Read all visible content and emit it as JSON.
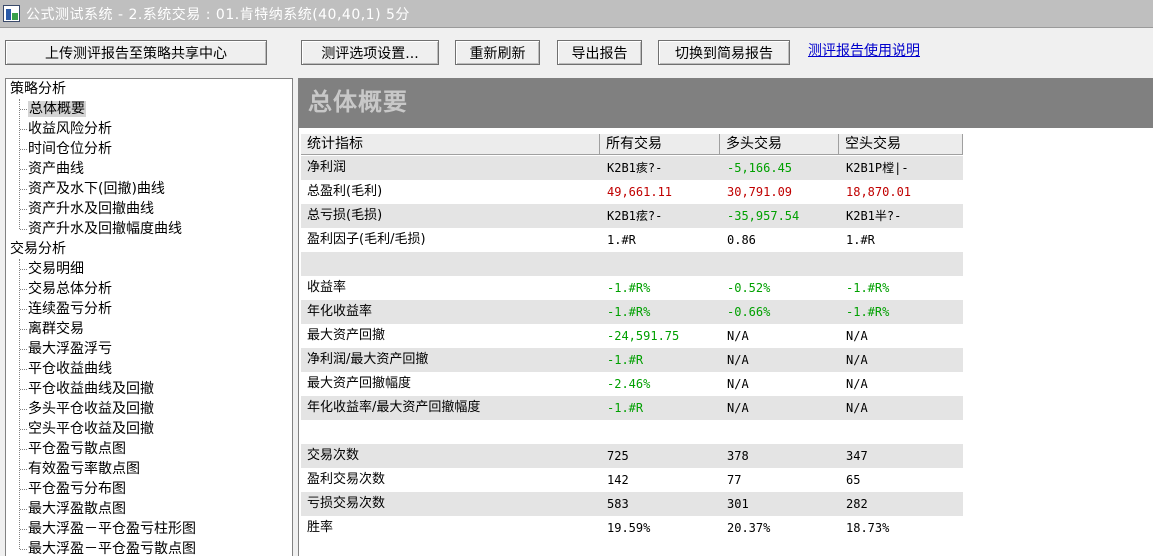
{
  "titlebar": {
    "title": "公式测试系统 - 2.系统交易 : 01.肯特纳系统(40,40,1) 5分"
  },
  "toolbar": {
    "upload_label": "上传测评报告至策略共享中心",
    "options_label": "测评选项设置...",
    "refresh_label": "重新刷新",
    "export_label": "导出报告",
    "simple_label": "切换到简易报告",
    "help_link": "测评报告使用说明"
  },
  "tree": {
    "groups": [
      {
        "label": "策略分析",
        "items": [
          "总体概要",
          "收益风险分析",
          "时间仓位分析",
          "资产曲线",
          "资产及水下(回撤)曲线",
          "资产升水及回撤曲线",
          "资产升水及回撤幅度曲线"
        ]
      },
      {
        "label": "交易分析",
        "items": [
          "交易明细",
          "交易总体分析",
          "连续盈亏分析",
          "离群交易",
          "最大浮盈浮亏",
          "平仓收益曲线",
          "平仓收益曲线及回撤",
          "多头平仓收益及回撤",
          "空头平仓收益及回撤",
          "平仓盈亏散点图",
          "有效盈亏率散点图",
          "平仓盈亏分布图",
          "最大浮盈散点图",
          "最大浮盈－平仓盈亏柱形图",
          "最大浮盈－平仓盈亏散点图"
        ]
      }
    ],
    "selected": "总体概要"
  },
  "content": {
    "page_title": "总体概要",
    "columns": [
      "统计指标",
      "所有交易",
      "多头交易",
      "空头交易"
    ],
    "rows": [
      {
        "label": "净利润",
        "all": "K2B1痎?-",
        "long": "-5,166.45",
        "short": "K2B1P樘|-"
      },
      {
        "label": "总盈利(毛利)",
        "all": "49,661.11",
        "long": "30,791.09",
        "short": "18,870.01"
      },
      {
        "label": "总亏损(毛损)",
        "all": "K2B1痃?-",
        "long": "-35,957.54",
        "short": "K2B1半?-"
      },
      {
        "label": "盈利因子(毛利/毛损)",
        "all": "1.#R",
        "long": "0.86",
        "short": "1.#R"
      },
      {
        "label": "",
        "all": "",
        "long": "",
        "short": ""
      },
      {
        "label": "收益率",
        "all": "-1.#R%",
        "long": "-0.52%",
        "short": "-1.#R%"
      },
      {
        "label": "年化收益率",
        "all": "-1.#R%",
        "long": "-0.66%",
        "short": "-1.#R%"
      },
      {
        "label": "最大资产回撤",
        "all": "-24,591.75",
        "long": "N/A",
        "short": "N/A"
      },
      {
        "label": "净利润/最大资产回撤",
        "all": "-1.#R",
        "long": "N/A",
        "short": "N/A"
      },
      {
        "label": "最大资产回撤幅度",
        "all": "-2.46%",
        "long": "N/A",
        "short": "N/A"
      },
      {
        "label": "年化收益率/最大资产回撤幅度",
        "all": "-1.#R",
        "long": "N/A",
        "short": "N/A"
      },
      {
        "label": "",
        "all": "",
        "long": "",
        "short": ""
      },
      {
        "label": "交易次数",
        "all": "725",
        "long": "378",
        "short": "347"
      },
      {
        "label": "盈利交易次数",
        "all": "142",
        "long": "77",
        "short": "65"
      },
      {
        "label": "亏损交易次数",
        "all": "583",
        "long": "301",
        "short": "282"
      },
      {
        "label": "胜率",
        "all": "19.59%",
        "long": "20.37%",
        "short": "18.73%"
      }
    ]
  },
  "colors": {
    "negative_value": "#00a000",
    "positive_value": "#c00000",
    "header_band": "#808080",
    "link": "#0000cc"
  }
}
